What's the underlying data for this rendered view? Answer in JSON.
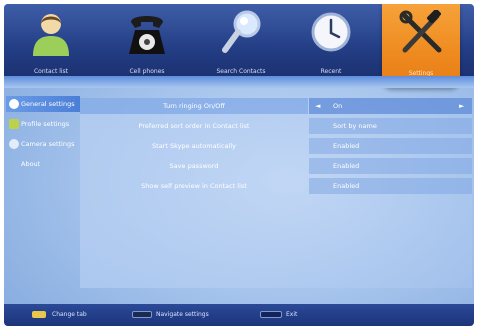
{
  "tabs": [
    {
      "label": "Contact list",
      "icon": "person-icon"
    },
    {
      "label": "Cell phones",
      "icon": "telephone-icon"
    },
    {
      "label": "Search Contacts",
      "icon": "magnifier-icon"
    },
    {
      "label": "Recent",
      "icon": "clock-icon"
    },
    {
      "label": "Settings",
      "icon": "tools-icon"
    }
  ],
  "sidebar": {
    "items": [
      {
        "label": "General settings"
      },
      {
        "label": "Profile settings"
      },
      {
        "label": "Camera settings"
      },
      {
        "label": "About"
      }
    ]
  },
  "settings": {
    "rows": [
      {
        "label": "Turn ringing On/Off",
        "value": "On"
      },
      {
        "label": "Preferred sort order in Contact list",
        "value": "Sort by name"
      },
      {
        "label": "Start Skype automatically",
        "value": "Enabled"
      },
      {
        "label": "Save password",
        "value": "Enabled"
      },
      {
        "label": "Show self preview in Contact list",
        "value": "Enabled"
      }
    ],
    "arrow_left": "◄",
    "arrow_right": "►"
  },
  "footer": {
    "hints": [
      {
        "label": "Change tab"
      },
      {
        "label": "Navigate settings"
      },
      {
        "label": "Exit"
      }
    ]
  },
  "colors": {
    "accent": "#ee8a1f",
    "bar": "#243f86",
    "background": "#a6c4ec"
  }
}
